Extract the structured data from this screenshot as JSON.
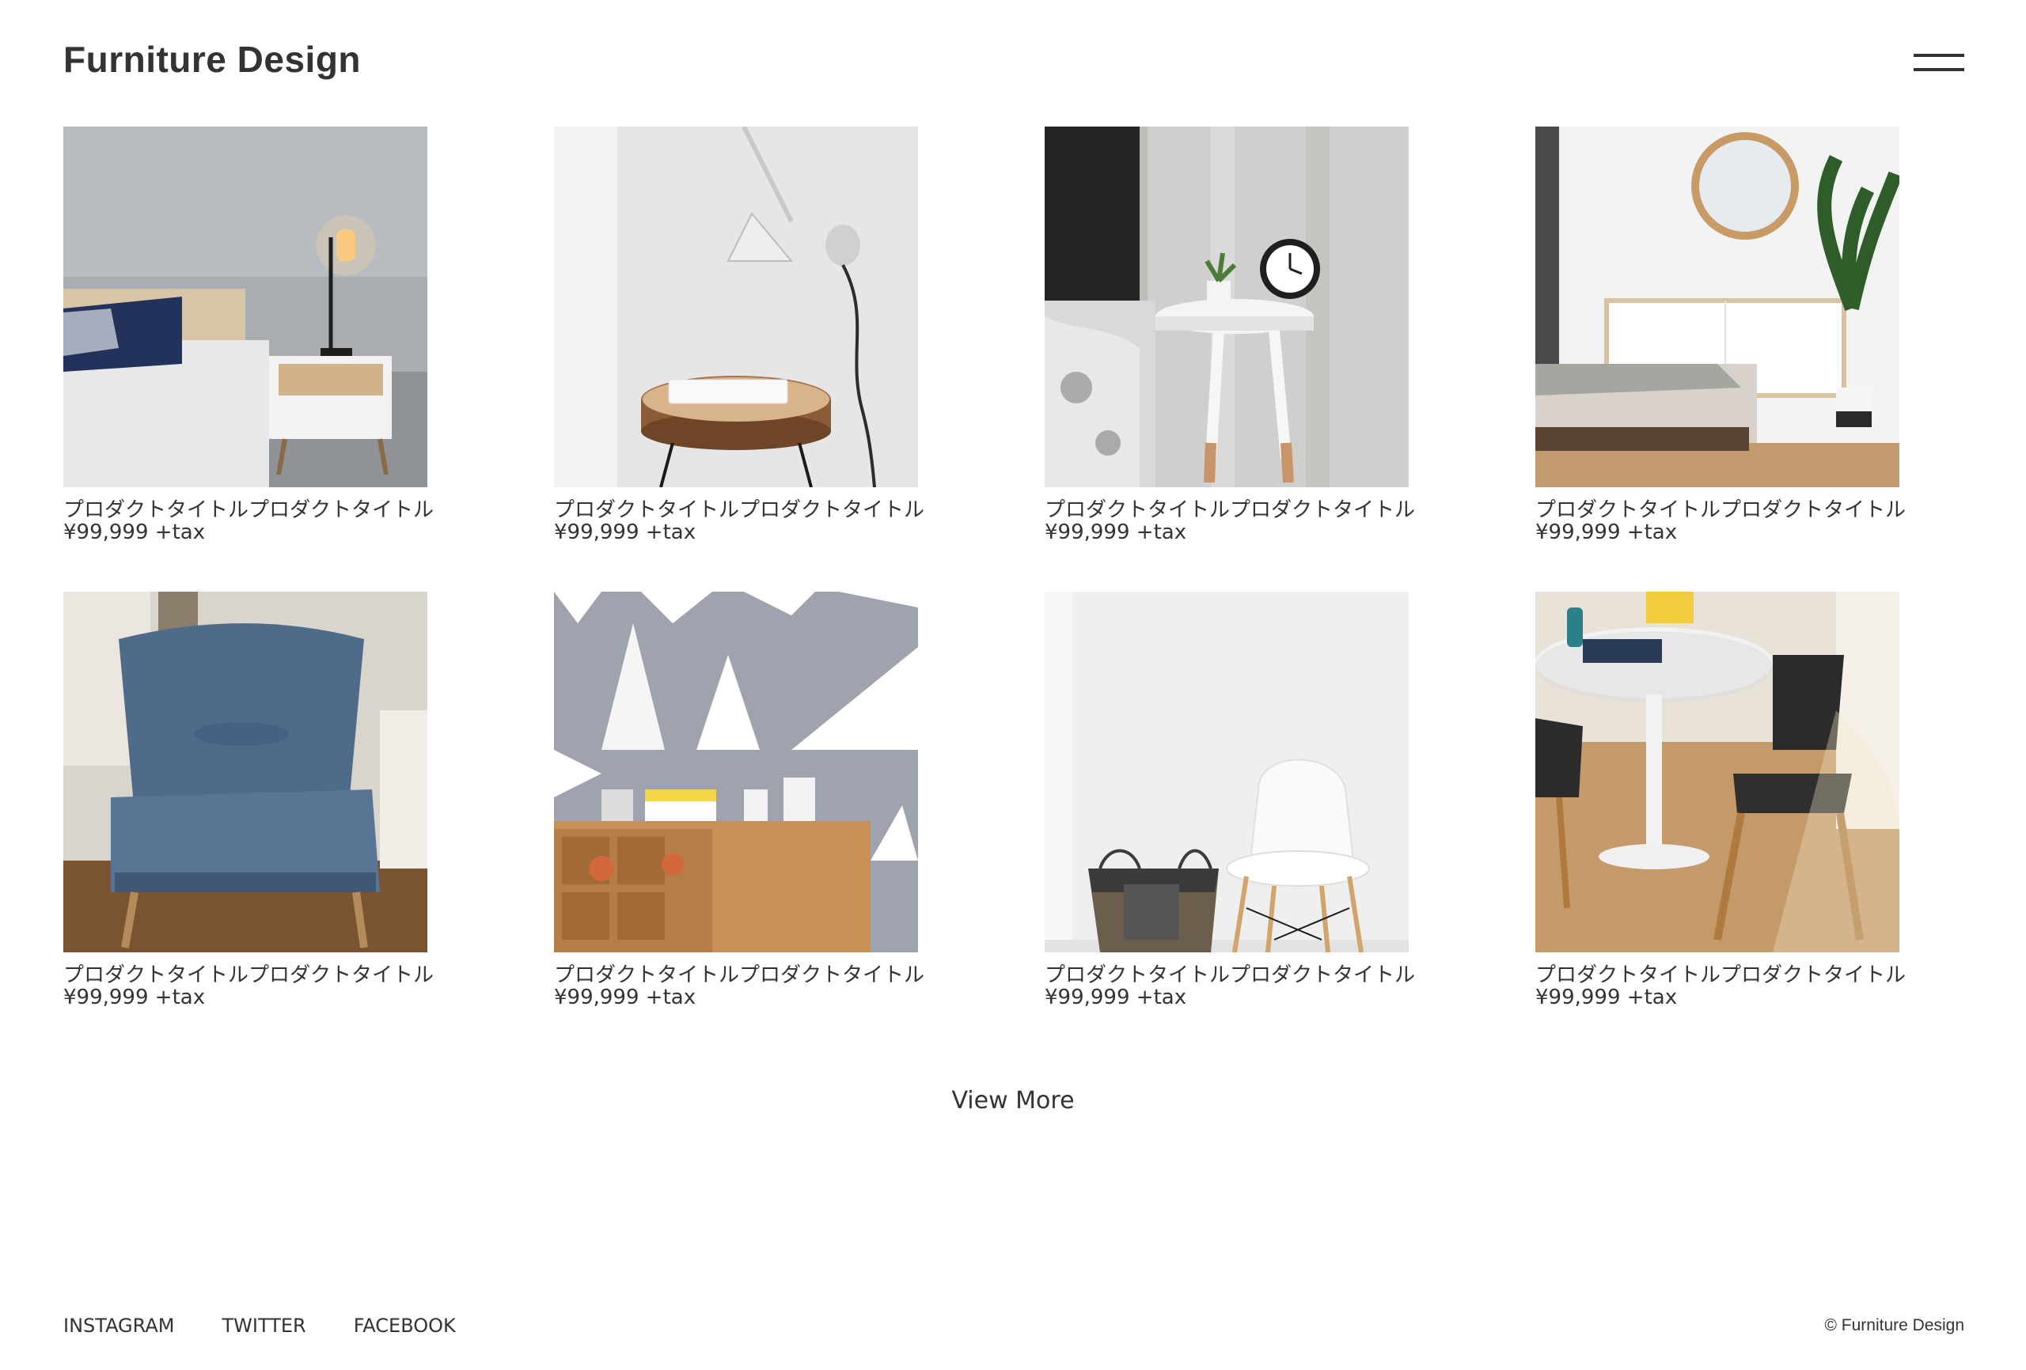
{
  "header": {
    "site_title": "Furniture Design",
    "menu_icon": "hamburger-menu-icon"
  },
  "products": [
    {
      "title": "プロダクトタイトルプロダクトタイトル",
      "price": "¥99,999 +tax",
      "image": "bedroom-nightstand-lamp"
    },
    {
      "title": "プロダクトタイトルプロダクトタイトル",
      "price": "¥99,999 +tax",
      "image": "wall-lamp-wood-stool"
    },
    {
      "title": "プロダクトタイトルプロダクトタイトル",
      "price": "¥99,999 +tax",
      "image": "white-side-table-clock"
    },
    {
      "title": "プロダクトタイトルプロダクトタイトル",
      "price": "¥99,999 +tax",
      "image": "round-mirror-sideboard"
    },
    {
      "title": "プロダクトタイトルプロダクトタイトル",
      "price": "¥99,999 +tax",
      "image": "blue-armchair"
    },
    {
      "title": "プロダクトタイトルプロダクトタイトル",
      "price": "¥99,999 +tax",
      "image": "geometric-wall-wood-cabinet"
    },
    {
      "title": "プロダクトタイトルプロダクトタイトル",
      "price": "¥99,999 +tax",
      "image": "white-chair-basket"
    },
    {
      "title": "プロダクトタイトルプロダクトタイトル",
      "price": "¥99,999 +tax",
      "image": "round-table-black-chairs"
    }
  ],
  "view_more": "View More",
  "footer": {
    "links": [
      "INSTAGRAM",
      "TWITTER",
      "FACEBOOK"
    ],
    "copyright": "© Furniture Design"
  },
  "colors": {
    "text": "#333333",
    "background": "#ffffff"
  }
}
